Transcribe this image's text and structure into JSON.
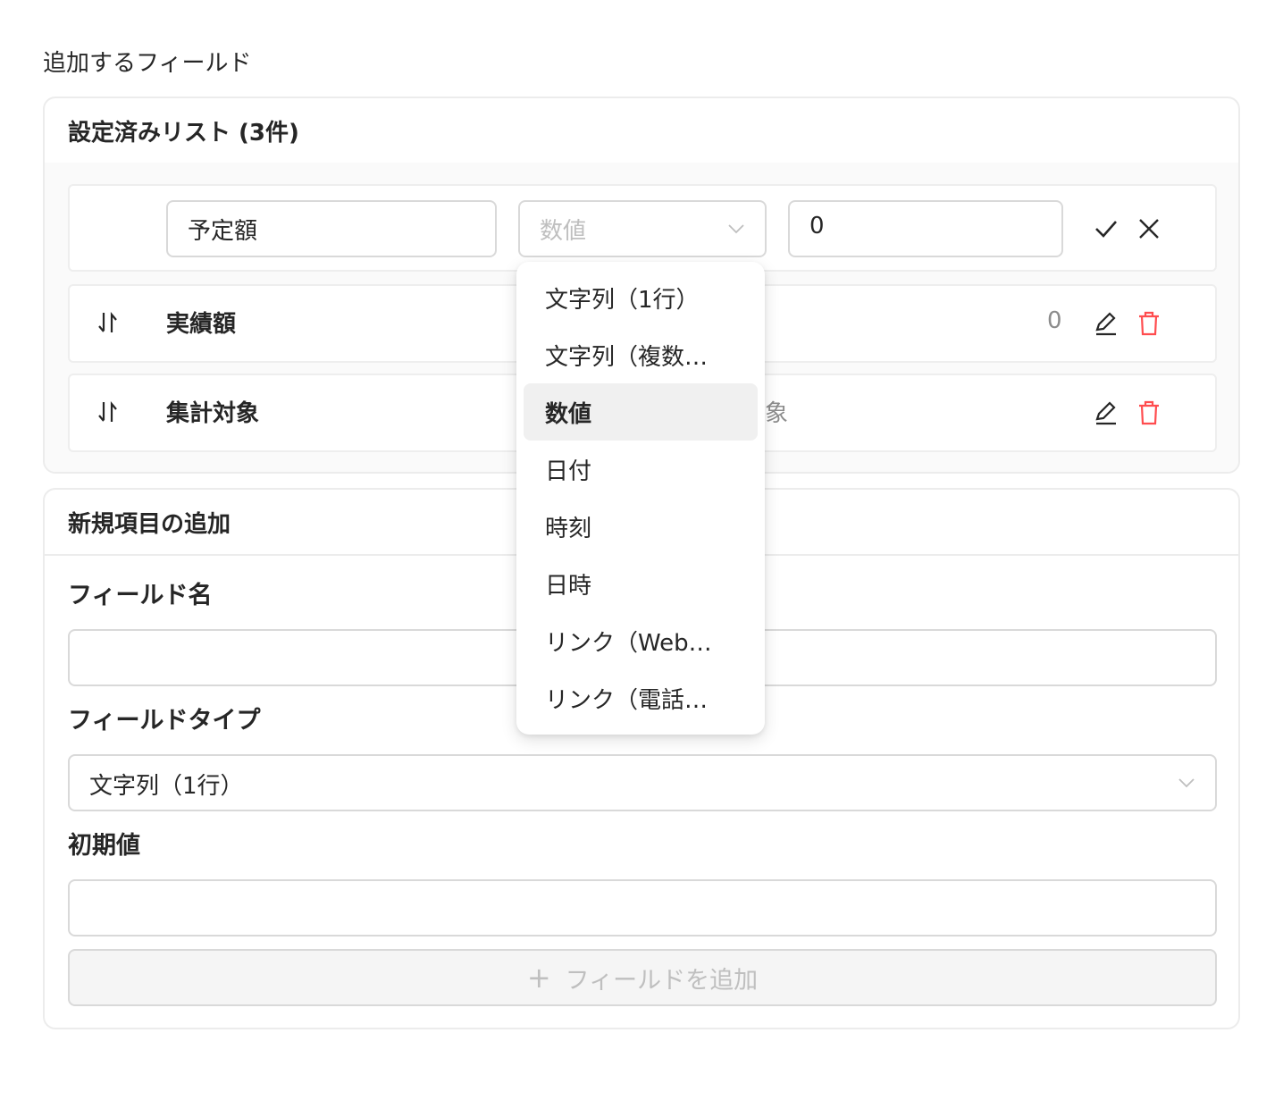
{
  "section_title": "追加するフィールド",
  "configured": {
    "title": "設定済みリスト (3件)",
    "editing_row": {
      "name_value": "予定額",
      "type_placeholder": "数値",
      "default_value": "0"
    },
    "rows": [
      {
        "name": "実績額",
        "default": "0"
      },
      {
        "name": "集計対象",
        "default": "象"
      }
    ]
  },
  "type_dropdown": {
    "options": [
      "文字列（1行）",
      "文字列（複数…",
      "数値",
      "日付",
      "時刻",
      "日時",
      "リンク（Web…",
      "リンク（電話…"
    ],
    "selected_index": 2
  },
  "new_item": {
    "title": "新規項目の追加",
    "name_label": "フィールド名",
    "name_value": "",
    "type_label": "フィールドタイプ",
    "type_value": "文字列（1行）",
    "default_label": "初期値",
    "default_value": "",
    "add_button": "フィールドを追加"
  },
  "colors": {
    "danger": "#ff4d4f",
    "border": "#d9d9d9",
    "muted": "#bfbfbf"
  }
}
